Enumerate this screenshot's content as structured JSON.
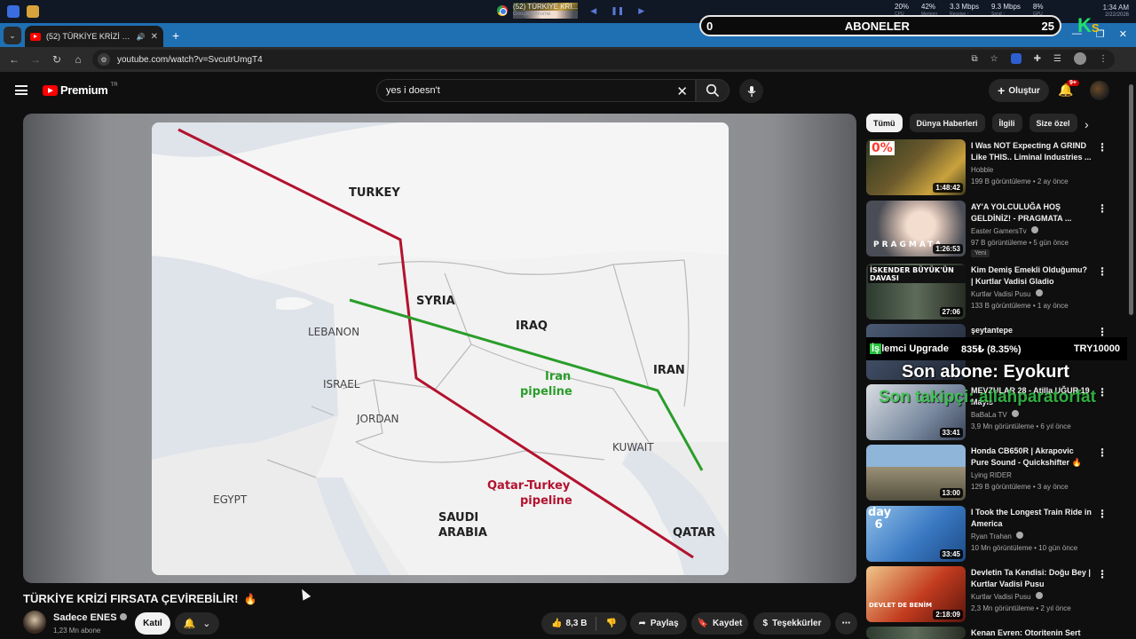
{
  "taskbar": {
    "window_title": "(52) TÜRKİYE KRİ...",
    "window_app": "Google Chrome",
    "stats": [
      {
        "value": "20%",
        "label": "CPU"
      },
      {
        "value": "42%",
        "label": "Memory"
      },
      {
        "value": "3.3 Mbps",
        "label": "Receive ↑"
      },
      {
        "value": "9.3 Mbps",
        "label": "Send ↑"
      },
      {
        "value": "8%",
        "label": "GPU"
      }
    ],
    "time": "1:34 AM",
    "date": "2/22/2026"
  },
  "browser": {
    "tab_title": "(52) TÜRKİYE KRİZİ FIRSATA",
    "url": "youtube.com/watch?v=SvcutrUmgT4"
  },
  "overlay": {
    "aboneler_label": "ABONELER",
    "aboneler_left": "0",
    "aboneler_right": "25",
    "upgrade_label_hl": "İş",
    "upgrade_label": "lemci Upgrade",
    "upgrade_pct": "835₺ (8.35%)",
    "upgrade_price": "TRY10000",
    "son_abone": "Son abone: Eyokurt",
    "son_takip": "Son takipçi: allahparatorfat"
  },
  "youtube": {
    "logo": "Premium",
    "logo_region": "TR",
    "search_value": "yes i doesn't",
    "create_label": "Oluştur",
    "notif_count": "9+"
  },
  "map": {
    "labels": {
      "turkey": "TURKEY",
      "syria": "SYRIA",
      "lebanon": "LEBANON",
      "iraq": "IRAQ",
      "iran": "IRAN",
      "israel": "ISRAEL",
      "jordan": "JORDAN",
      "kuwait": "KUWAIT",
      "egypt": "EGYPT",
      "saudi1": "SAUDI",
      "saudi2": "ARABIA",
      "qatar": "QATAR",
      "iran_pipe1": "Iran",
      "iran_pipe2": "pipeline",
      "qt_pipe1": "Qatar-Turkey",
      "qt_pipe2": "pipeline"
    },
    "colors": {
      "qatar_turkey": "#b3122e",
      "iran": "#2a9d2a",
      "land": "#f3f3f3",
      "water": "#dfe3ea"
    }
  },
  "video": {
    "title": "TÜRKİYE KRİZİ FIRSATA ÇEVİREBİLİR!",
    "channel": "Sadece ENES",
    "subs": "1,23 Mn abone",
    "join": "Katıl",
    "likes": "8,3 B",
    "share": "Paylaş",
    "save": "Kaydet",
    "thanks": "Teşekkürler"
  },
  "chips": [
    "Tümü",
    "Dünya Haberleri",
    "İlgili",
    "Size özel"
  ],
  "recommendations": [
    {
      "title": "I Was NOT Expecting A GRIND Like THIS.. Liminal Industries ...",
      "channel": "Hobble",
      "meta": "199 B görüntüleme • 2 ay önce",
      "duration": "1:48:42",
      "thumb_text": "0%"
    },
    {
      "title": "AY'A YOLCULUĞA HOŞ GELDİNİZ! - PRAGMATA ...",
      "channel": "Easter GamersTv",
      "meta": "97 B görüntüleme • 5 gün önce",
      "duration": "1:26:53",
      "badge": "Yeni",
      "thumb_text": "PRAGMATA"
    },
    {
      "title": "Kim Demiş Emekli Olduğumu? | Kurtlar Vadisi Gladio",
      "channel": "Kurtlar Vadisi Pusu",
      "meta": "133 B görüntüleme • 1 ay önce",
      "duration": "27:06",
      "thumb_text": "İSKENDER BÜYÜK'ÜN DAVASI"
    },
    {
      "title": "şeytantepe",
      "channel": "",
      "meta": "",
      "duration": "",
      "thumb_text": ""
    },
    {
      "title": "MEVZULAR 28 - Atilla UĞUR 19 Mayıs",
      "channel": "BaBaLa TV",
      "meta": "3,9 Mn görüntüleme • 6 yıl önce",
      "duration": "33:41",
      "thumb_text": ""
    },
    {
      "title": "Honda CB650R | Akrapovic Pure Sound - Quickshifter 🔥 4K",
      "channel": "Lying RIDER",
      "meta": "129 B görüntüleme • 3 ay önce",
      "duration": "13:00",
      "thumb_text": ""
    },
    {
      "title": "I Took the Longest Train Ride in America",
      "channel": "Ryan Trahan",
      "meta": "10 Mn görüntüleme • 10 gün önce",
      "duration": "33:45",
      "thumb_text": "day 6"
    },
    {
      "title": "Devletin Ta Kendisi: Doğu Bey | Kurtlar Vadisi Pusu",
      "channel": "Kurtlar Vadisi Pusu",
      "meta": "2,3 Mn görüntüleme • 2 yıl önce",
      "duration": "2:18:09",
      "thumb_text": "DEVLET DE BENİM"
    },
    {
      "title": "Kenan Evren: Otoritenin Sert",
      "channel": "",
      "meta": "",
      "duration": "",
      "thumb_text": ""
    }
  ]
}
